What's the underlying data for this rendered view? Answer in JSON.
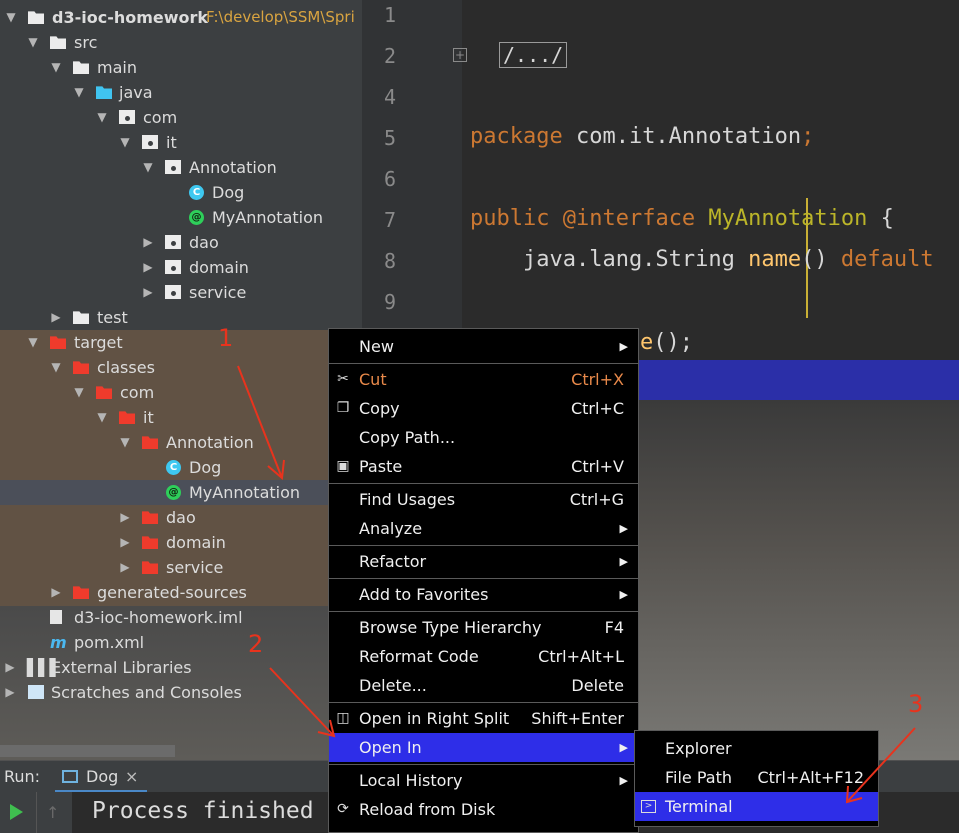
{
  "tree": {
    "project_name": "d3-ioc-homework",
    "project_path": "F:\\develop\\SSM\\Spri",
    "items": [
      {
        "label": "src"
      },
      {
        "label": "main"
      },
      {
        "label": "java"
      },
      {
        "label": "com"
      },
      {
        "label": "it"
      },
      {
        "label": "Annotation"
      },
      {
        "label": "Dog"
      },
      {
        "label": "MyAnnotation"
      },
      {
        "label": "dao"
      },
      {
        "label": "domain"
      },
      {
        "label": "service"
      },
      {
        "label": "test"
      },
      {
        "label": "target"
      },
      {
        "label": "classes"
      },
      {
        "label": "com"
      },
      {
        "label": "it"
      },
      {
        "label": "Annotation"
      },
      {
        "label": "Dog"
      },
      {
        "label": "MyAnnotation"
      },
      {
        "label": "dao"
      },
      {
        "label": "domain"
      },
      {
        "label": "service"
      },
      {
        "label": "generated-sources"
      },
      {
        "label": "d3-ioc-homework.iml"
      },
      {
        "label": "pom.xml"
      },
      {
        "label": "External Libraries"
      },
      {
        "label": "Scratches and Consoles"
      }
    ]
  },
  "editor": {
    "line_numbers": [
      "1",
      "2",
      "4",
      "5",
      "6",
      "7",
      "8",
      "9"
    ],
    "fold_text": "/.../",
    "line5_kw": "package",
    "line5_rest": " com.it.Annotation",
    "line5_end": ";",
    "line7_kw": "public",
    "line7_an": " @interface",
    "line7_name": " MyAnnotation",
    "line7_brace": " {",
    "line8_pre": "    java.lang.String ",
    "line8_fn": "name",
    "line8_paren": "() ",
    "line8_kw": "default",
    "line10_fn": "e",
    "line10_rest": "();"
  },
  "context_menu": {
    "items": [
      {
        "label": "New",
        "shortcut": ""
      },
      {
        "label": "Cut",
        "shortcut": "Ctrl+X"
      },
      {
        "label": "Copy",
        "shortcut": "Ctrl+C"
      },
      {
        "label": "Copy Path...",
        "shortcut": ""
      },
      {
        "label": "Paste",
        "shortcut": "Ctrl+V"
      },
      {
        "label": "Find Usages",
        "shortcut": "Ctrl+G"
      },
      {
        "label": "Analyze",
        "shortcut": ""
      },
      {
        "label": "Refactor",
        "shortcut": ""
      },
      {
        "label": "Add to Favorites",
        "shortcut": ""
      },
      {
        "label": "Browse Type Hierarchy",
        "shortcut": "F4"
      },
      {
        "label": "Reformat Code",
        "shortcut": "Ctrl+Alt+L"
      },
      {
        "label": "Delete...",
        "shortcut": "Delete"
      },
      {
        "label": "Open in Right Split",
        "shortcut": "Shift+Enter"
      },
      {
        "label": "Open In",
        "shortcut": ""
      },
      {
        "label": "Local History",
        "shortcut": ""
      },
      {
        "label": "Reload from Disk",
        "shortcut": ""
      }
    ]
  },
  "submenu": {
    "items": [
      {
        "label": "Explorer",
        "shortcut": ""
      },
      {
        "label": "File Path",
        "shortcut": "Ctrl+Alt+F12"
      },
      {
        "label": "Terminal",
        "shortcut": ""
      }
    ]
  },
  "run_bar": {
    "label": "Run:",
    "tab": "Dog",
    "close": "×"
  },
  "console": {
    "text": "Process finished"
  },
  "annotations": [
    "1",
    "2",
    "3"
  ],
  "colors": {
    "highlight": "#2e2ee8",
    "annotation_red": "#e8331d"
  }
}
